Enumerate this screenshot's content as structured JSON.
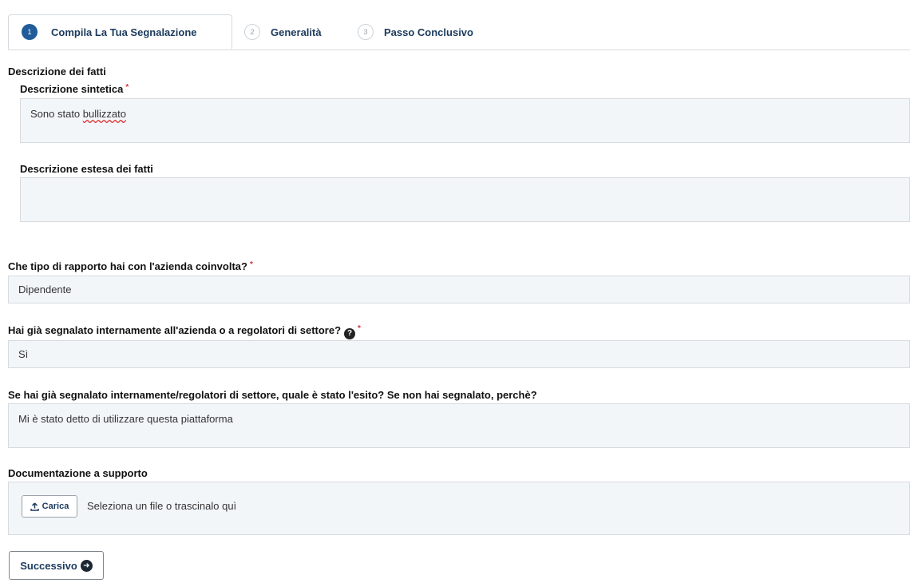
{
  "tabs": [
    {
      "number": "1",
      "label": "Compila La Tua Segnalazione"
    },
    {
      "number": "2",
      "label": "Generalità"
    },
    {
      "number": "3",
      "label": "Passo Conclusivo"
    }
  ],
  "section_title": "Descrizione dei fatti",
  "fields": {
    "short_description": {
      "label": "Descrizione sintetica",
      "required": "*",
      "value": "Sono stato ",
      "value_misspelled": "bullizzato"
    },
    "long_description": {
      "label": "Descrizione estesa dei fatti",
      "value": ""
    },
    "relationship": {
      "label": "Che tipo di rapporto hai con l'azienda coinvolta?",
      "required": "*",
      "value": "Dipendente"
    },
    "reported_internally": {
      "label": "Hai già segnalato internamente all'azienda o a regolatori di settore?",
      "required": "*",
      "value": "Sì",
      "help_icon": "question-circle-icon"
    },
    "outcome": {
      "label": "Se hai già segnalato internamente/regolatori di settore, quale è stato l'esito? Se non hai segnalato, perchè?",
      "value": "Mi è stato detto di utilizzare questa piattaforma"
    },
    "documents": {
      "label": "Documentazione a supporto",
      "upload_label": "Carica",
      "upload_hint": "Seleziona un file o trascinalo quì",
      "upload_icon": "upload-icon"
    }
  },
  "next_button": {
    "label": "Successivo",
    "icon": "arrow-circle-right-icon"
  },
  "colors": {
    "primary": "#1f5c99",
    "field_bg": "#f3f6f9",
    "required": "#dd3333"
  }
}
